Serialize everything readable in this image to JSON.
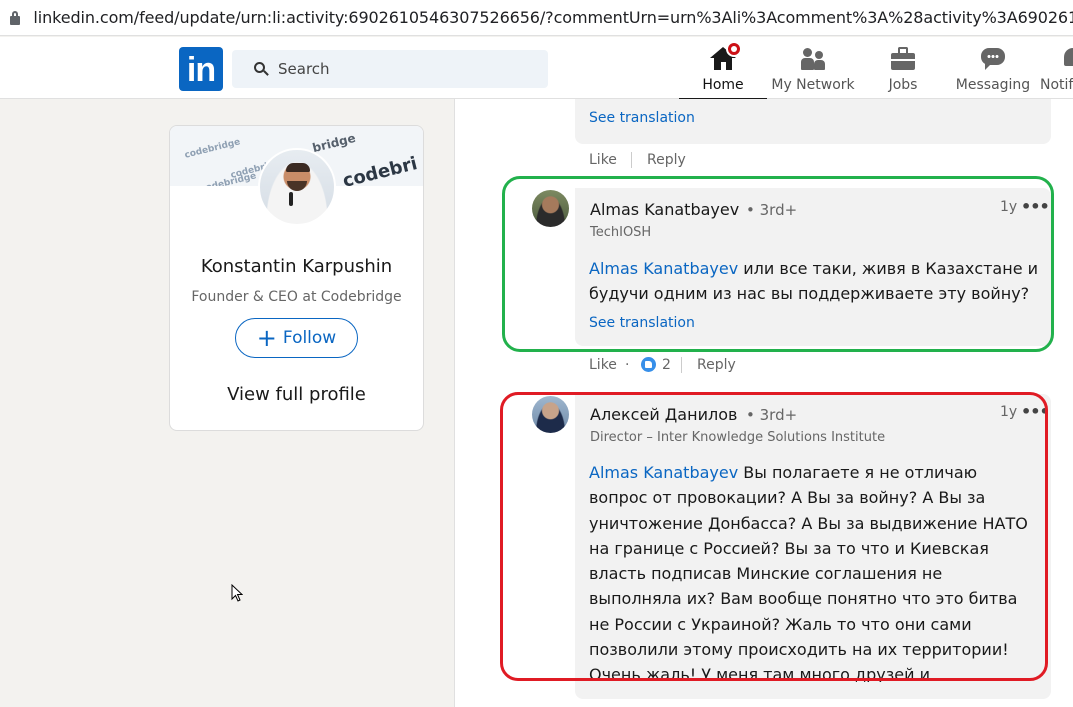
{
  "browser": {
    "url": "linkedin.com/feed/update/urn:li:activity:6902610546307526656/?commentUrn=urn%3Ali%3Acomment%3A%28activity%3A6902610546"
  },
  "nav": {
    "logo": "in",
    "search_placeholder": "Search",
    "items": [
      {
        "label": "Home",
        "icon": "home-icon",
        "active": true
      },
      {
        "label": "My Network",
        "icon": "network-icon"
      },
      {
        "label": "Jobs",
        "icon": "jobs-icon"
      },
      {
        "label": "Messaging",
        "icon": "messaging-icon"
      },
      {
        "label": "Notifi",
        "icon": "bell-icon"
      }
    ]
  },
  "profile_card": {
    "cover_text": [
      "codebri",
      "bridge",
      "codebridge",
      "codebridge",
      "codebridge",
      "bridge"
    ],
    "name": "Konstantin Karpushin",
    "headline": "Founder & CEO at Codebridge",
    "follow_label": "Follow",
    "follow_icon": "+",
    "view_profile": "View full profile"
  },
  "feed": {
    "top_comment": {
      "see_translation": "See translation",
      "like": "Like",
      "reply": "Reply"
    },
    "comments": [
      {
        "author": "Almas Kanatbayev",
        "degree": "• 3rd+",
        "subtitle": "TechIOSH",
        "time": "1y",
        "more": "•••",
        "mention": "Almas Kanatbayev",
        "text": " или все таки, живя в Казахстане и будучи одним из нас вы поддерживаете эту войну?",
        "see_translation": "See translation",
        "like": "Like",
        "dot": "·",
        "reactions": "2",
        "reply": "Reply",
        "highlight_color": "#22b14c"
      },
      {
        "author": "Алексей Данилов",
        "degree": "• 3rd+",
        "subtitle": "Director – Inter Knowledge Solutions Institute",
        "time": "1y",
        "more": "•••",
        "mention": "Almas Kanatbayev",
        "text": " Вы полагаете я не отличаю вопрос от провокации? А Вы за войну? А Вы за уничтожение Донбасса? А Вы за выдвижение НАТО на границе с Россией? Вы за то что и Киевская власть подписав Минские соглашения не выполняла их? Вам вообще понятно что это битва не России с Украиной? Жаль то что они сами позволили этому происходить на их территории! Очень жаль! У меня там много друзей и родственников.....",
        "highlight_color": "#e01b24"
      }
    ]
  },
  "colors": {
    "linkedin_blue": "#0a66c2",
    "notification_red": "#cc1016"
  }
}
